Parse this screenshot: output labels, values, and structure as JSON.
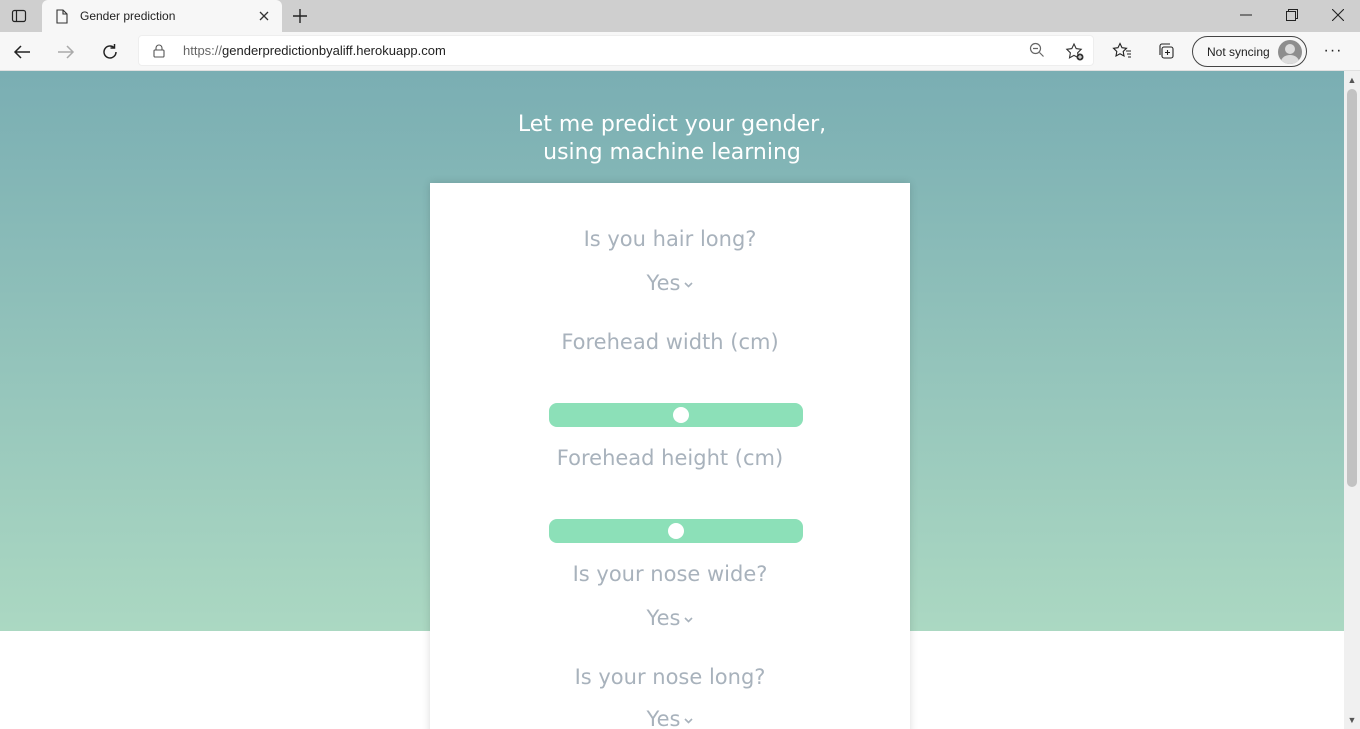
{
  "browser": {
    "tab_title": "Gender prediction",
    "url_prefix": "https://",
    "url_host": "genderpredictionbyaliff.herokuapp.com",
    "sync_label": "Not syncing"
  },
  "page": {
    "heading_line1": "Let me predict your gender,",
    "heading_line2": "using machine learning",
    "hair_question": "Is you hair long?",
    "hair_value": "Yes",
    "forehead_width_label": "Forehead width (cm)",
    "forehead_width_level": 0.52,
    "forehead_height_label": "Forehead height (cm)",
    "forehead_height_level": 0.5,
    "nose_wide_question": "Is your nose wide?",
    "nose_wide_value": "Yes",
    "nose_long_question": "Is your nose long?",
    "nose_long_value": "Yes"
  },
  "colors": {
    "hero_top": "#7aaeb3",
    "hero_bottom": "#abd8c2",
    "slider_track": "#8ce0b8",
    "question_text": "#a8b2bc"
  }
}
